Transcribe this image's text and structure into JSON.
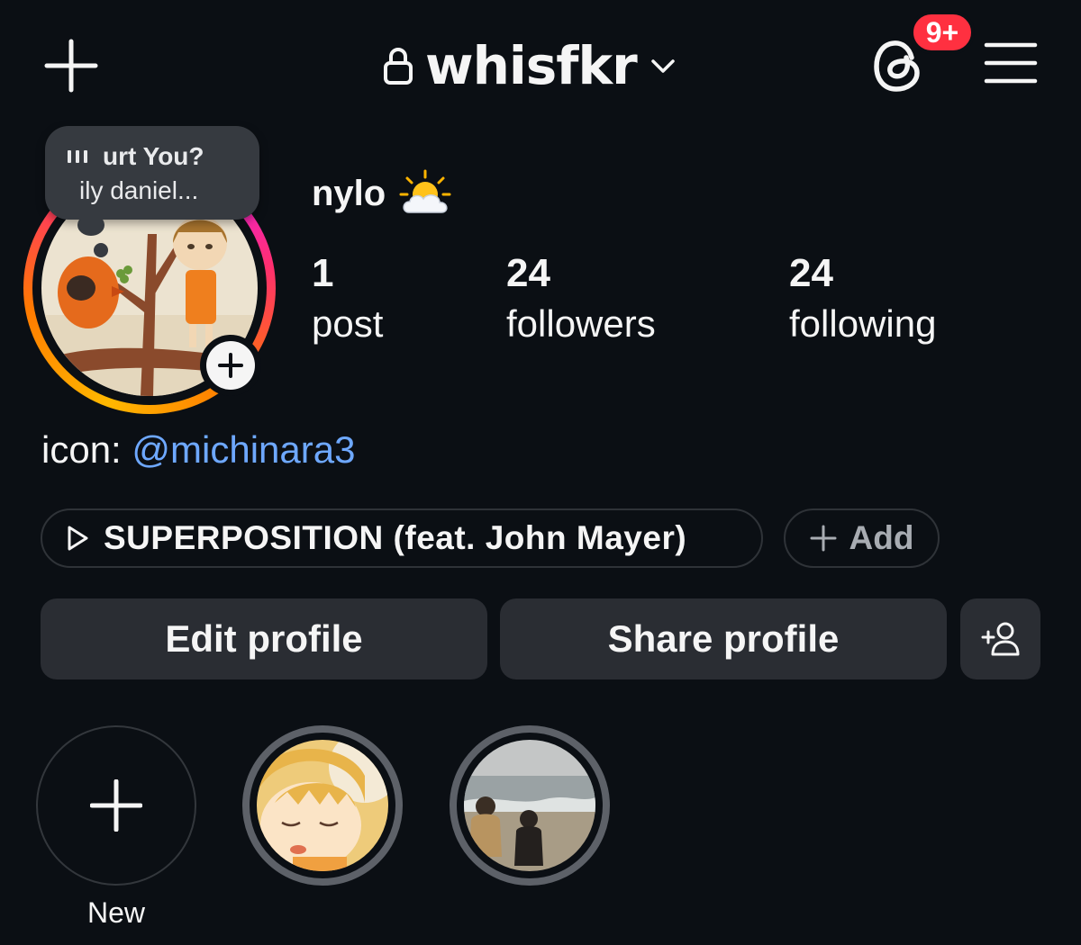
{
  "header": {
    "username": "whisfkr",
    "notification_badge": "9+",
    "icons": {
      "create": "plus-icon",
      "lock": "lock-icon",
      "account_switcher": "chevron-down-icon",
      "threads": "threads-icon",
      "menu": "hamburger-menu-icon"
    }
  },
  "note": {
    "song_line": "urt You?",
    "artist_line": "ily daniel..."
  },
  "profile": {
    "display_name": "nylo",
    "status_emoji": "sun-behind-cloud-icon"
  },
  "stats": [
    {
      "value": "1",
      "label": "post"
    },
    {
      "value": "24",
      "label": "followers"
    },
    {
      "value": "24",
      "label": "following"
    }
  ],
  "bio": {
    "prefix": "icon: ",
    "mention": "@michinara3"
  },
  "music": {
    "title": "SUPERPOSITION (feat. John Mayer)",
    "add_label": "Add"
  },
  "actions": {
    "edit_label": "Edit profile",
    "share_label": "Share profile"
  },
  "highlights": {
    "new_label": "New"
  },
  "colors": {
    "background": "#0b0f14",
    "button_bg": "#2a2d33",
    "mention": "#6ea8ff",
    "badge": "#ff3040",
    "story_ring_start": "#ffb800",
    "story_ring_end": "#e81cff"
  }
}
